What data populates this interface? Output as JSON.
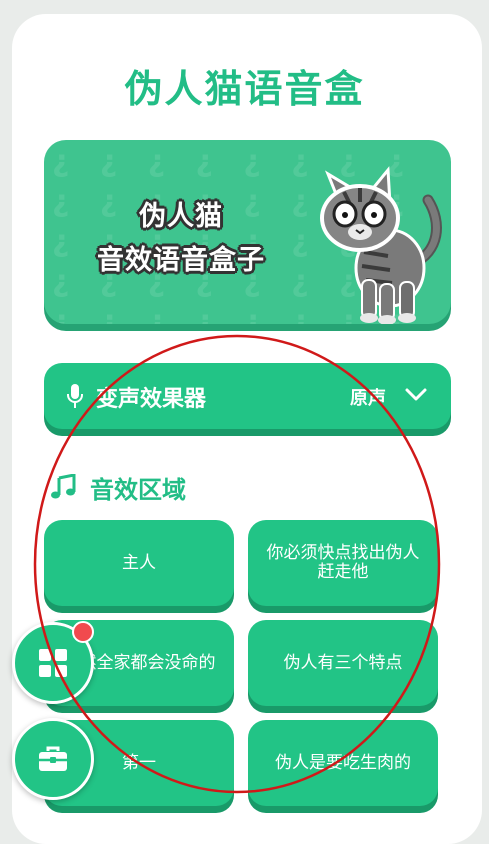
{
  "app": {
    "title": "伪人猫语音盒"
  },
  "banner": {
    "line1": "伪人猫",
    "line2": "音效语音盒子",
    "pattern_glyph": "¿ ¿ ¿ ¿ ¿ ¿ ¿ ¿ ¿ ¿ ¿ ¿ ¿ ¿ ¿ ¿ ¿ ¿ ¿ ¿ ¿ ¿ ¿ ¿ ¿ ¿ ¿ ¿ ¿ ¿ ¿ ¿ ¿ ¿ ¿ ¿ ¿ ¿ ¿ ¿ ¿ ¿ ¿ ¿ ¿ ¿ ¿ ¿"
  },
  "voice_changer": {
    "label": "变声效果器",
    "current": "原声",
    "icon": "mic-icon"
  },
  "sound_section": {
    "title": "音效区域",
    "icon": "music-note-icon",
    "buttons": [
      {
        "label": "主人"
      },
      {
        "label": "你必须快点找出伪人赶走他"
      },
      {
        "label": "不然全家都会没命的"
      },
      {
        "label": "伪人有三个特点"
      },
      {
        "label": "第一"
      },
      {
        "label": "伪人是要吃生肉的"
      }
    ]
  },
  "fabs": [
    {
      "icon": "grid-apps-icon"
    },
    {
      "icon": "toolbox-icon"
    }
  ],
  "colors": {
    "primary": "#22c486",
    "primary_dark": "#199a69",
    "title_green": "#22bd86",
    "badge_red": "#f14a4e",
    "annotation_red": "#d01919"
  }
}
